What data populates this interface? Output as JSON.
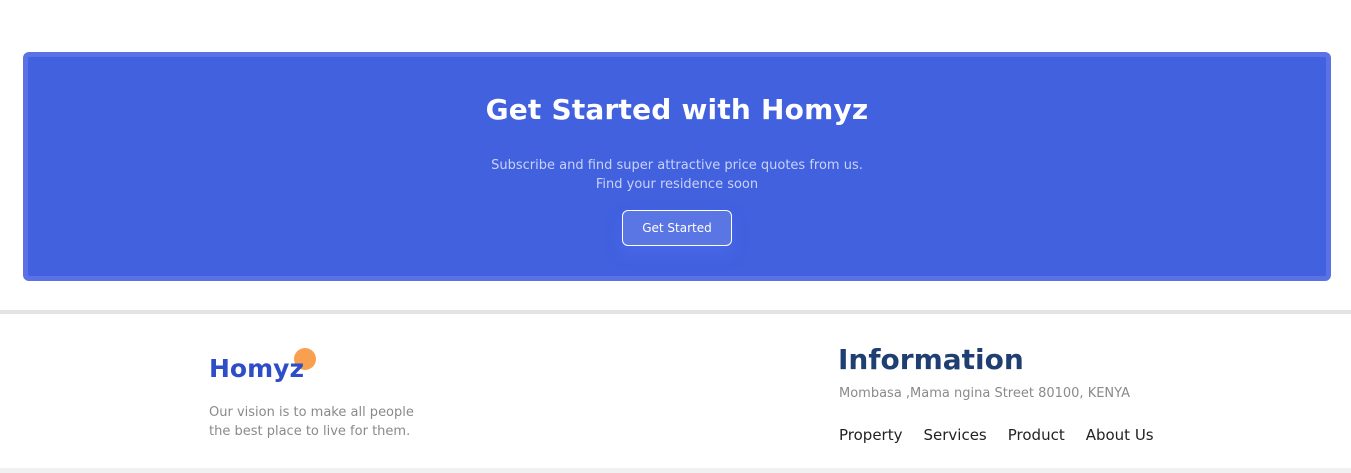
{
  "cta": {
    "title": "Get Started with Homyz",
    "subtitle_line1": "Subscribe and find super attractive price quotes from us.",
    "subtitle_line2": "Find your residence soon",
    "button_label": "Get Started",
    "background_color": "#4161df"
  },
  "footer": {
    "brand": "Homyz",
    "brand_color": "#2e4dc8",
    "brand_dot_color": "#f9a050",
    "vision_line1": "Our vision is to make all people",
    "vision_line2": "the best place to live for them.",
    "info_title": "Information",
    "address": "Mombasa ,Mama ngina Street 80100, KENYA",
    "links": [
      "Property",
      "Services",
      "Product",
      "About Us"
    ]
  }
}
